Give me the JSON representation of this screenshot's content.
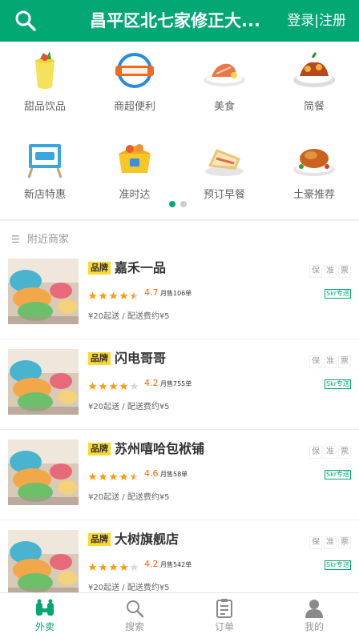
{
  "header": {
    "title": "昌平区北七家修正大...",
    "login": "登录|注册"
  },
  "categories": [
    {
      "label": "甜品饮品",
      "icon": "drink-icon"
    },
    {
      "label": "商超便利",
      "icon": "supermarket-icon"
    },
    {
      "label": "美食",
      "icon": "food-icon"
    },
    {
      "label": "简餐",
      "icon": "meal-icon"
    },
    {
      "label": "新店特惠",
      "icon": "newstore-icon"
    },
    {
      "label": "准时达",
      "icon": "ontime-icon"
    },
    {
      "label": "预订早餐",
      "icon": "breakfast-icon"
    },
    {
      "label": "土豪推荐",
      "icon": "chicken-icon"
    }
  ],
  "carousel": {
    "active": 0,
    "count": 2
  },
  "nearby": {
    "title": "附近商家"
  },
  "shops": [
    {
      "brand": "品牌",
      "name": "嘉禾一品",
      "rating": "4.7",
      "stars": 4.5,
      "sales": "月售106单",
      "delivery": "Skr专送",
      "fee": "¥20起送 / 配送费约¥5",
      "tags": [
        "保",
        "准",
        "票"
      ]
    },
    {
      "brand": "品牌",
      "name": "闪电哥哥",
      "rating": "4.2",
      "stars": 4,
      "sales": "月售755单",
      "delivery": "Skr专送",
      "fee": "¥20起送 / 配送费约¥5",
      "tags": [
        "保",
        "准",
        "票"
      ]
    },
    {
      "brand": "品牌",
      "name": "苏州嘻哈包袱铺",
      "rating": "4.6",
      "stars": 4.5,
      "sales": "月售58单",
      "delivery": "Skr专送",
      "fee": "¥20起送 / 配送费约¥5",
      "tags": [
        "保",
        "准",
        "票"
      ]
    },
    {
      "brand": "品牌",
      "name": "大树旗舰店",
      "rating": "4.2",
      "stars": 4,
      "sales": "月售542单",
      "delivery": "Skr专送",
      "fee": "¥20起送 / 配送费约¥5",
      "tags": [
        "保",
        "准",
        "票"
      ]
    }
  ],
  "bottom_nav": [
    {
      "label": "外卖",
      "icon": "takeout-icon",
      "active": true
    },
    {
      "label": "搜索",
      "icon": "search-icon",
      "active": false
    },
    {
      "label": "订单",
      "icon": "order-icon",
      "active": false
    },
    {
      "label": "我的",
      "icon": "profile-icon",
      "active": false
    }
  ],
  "colors": {
    "primary": "#02a774",
    "star": "#ff9a0d",
    "rating": "#ff6000",
    "brand_badge": "#ffd930"
  }
}
